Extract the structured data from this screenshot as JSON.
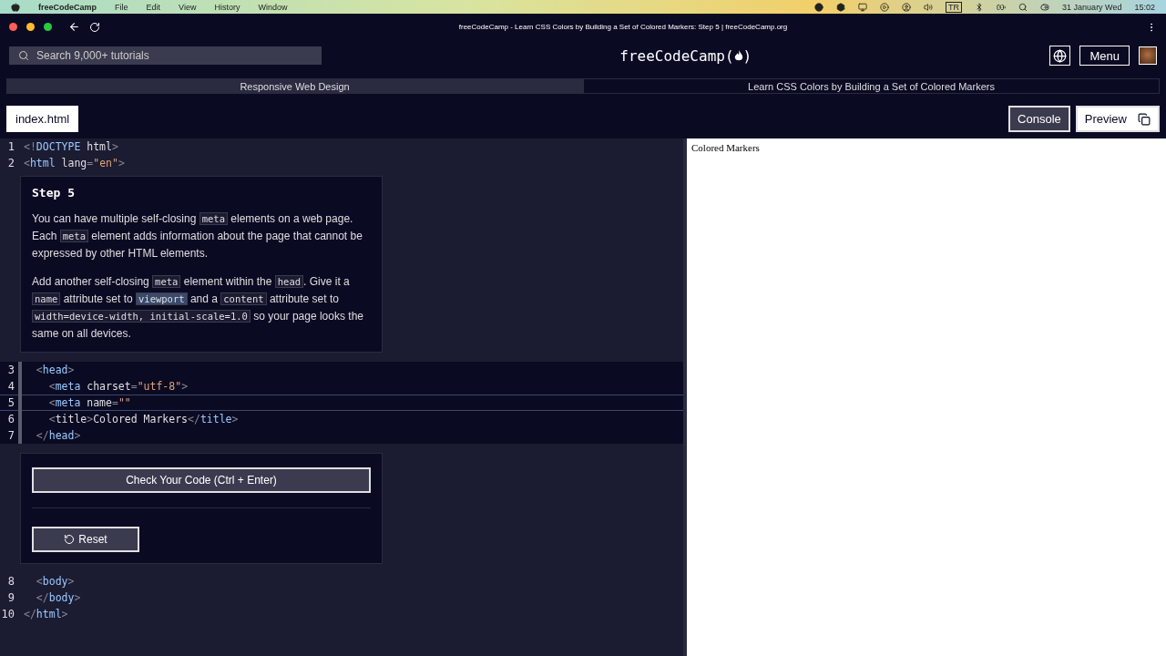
{
  "menu_bar": {
    "app": "freeCodeCamp",
    "items": [
      "File",
      "Edit",
      "View",
      "History",
      "Window"
    ],
    "input_source": "TR",
    "date": "31 January Wed",
    "time": "15:02"
  },
  "browser": {
    "title": "freeCodeCamp - Learn CSS Colors by Building a Set of Colored Markers: Step 5 | freeCodeCamp.org"
  },
  "nav": {
    "search": {
      "placeholder": "Search 9,000+ tutorials"
    },
    "logo": {
      "text": "freeCodeCamp",
      "open": "(",
      "close": ")"
    },
    "menu_button": "Menu"
  },
  "breadcrumb": [
    "Responsive Web Design",
    "Learn CSS Colors by Building a Set of Colored Markers"
  ],
  "file_tabs": [
    {
      "label": "index.html",
      "selected": true
    }
  ],
  "view_buttons": [
    {
      "label": "Console",
      "selected": false
    },
    {
      "label": "Preview",
      "selected": true
    }
  ],
  "editor": {
    "lines_before": [
      {
        "number": "1",
        "editable": false,
        "active": false,
        "tokens": [
          {
            "kind": "punct",
            "text": "<!"
          },
          {
            "kind": "tag",
            "text": "DOCTYPE"
          },
          {
            "kind": "attr",
            "text": " html"
          },
          {
            "kind": "punct",
            "text": ">"
          }
        ]
      },
      {
        "number": "2",
        "editable": false,
        "active": false,
        "tokens": [
          {
            "kind": "punct",
            "text": "<"
          },
          {
            "kind": "tag",
            "text": "html"
          },
          {
            "kind": "attr",
            "text": " lang"
          },
          {
            "kind": "punct",
            "text": "="
          },
          {
            "kind": "str",
            "text": "\"en\""
          },
          {
            "kind": "punct",
            "text": ">"
          }
        ]
      }
    ],
    "step": {
      "title": "Step 5",
      "paragraphs": [
        [
          {
            "kind": "text",
            "text": "You can have multiple self-closing "
          },
          {
            "kind": "code",
            "text": "meta",
            "highlighted": false
          },
          {
            "kind": "text",
            "text": " elements on a web page. Each "
          },
          {
            "kind": "code",
            "text": "meta",
            "highlighted": false
          },
          {
            "kind": "text",
            "text": " element adds information about the page that cannot be expressed by other HTML elements."
          }
        ],
        [
          {
            "kind": "text",
            "text": "Add another self-closing "
          },
          {
            "kind": "code",
            "text": "meta",
            "highlighted": false
          },
          {
            "kind": "text",
            "text": " element within the "
          },
          {
            "kind": "code",
            "text": "head",
            "highlighted": false
          },
          {
            "kind": "text",
            "text": ". Give it a "
          },
          {
            "kind": "code",
            "text": "name",
            "highlighted": false
          },
          {
            "kind": "text",
            "text": " attribute set to "
          },
          {
            "kind": "code",
            "text": "viewport",
            "highlighted": true
          },
          {
            "kind": "text",
            "text": " and a "
          },
          {
            "kind": "code",
            "text": "content",
            "highlighted": false
          },
          {
            "kind": "text",
            "text": " attribute set to "
          },
          {
            "kind": "code",
            "text": "width=device-width, initial-scale=1.0",
            "highlighted": false
          },
          {
            "kind": "text",
            "text": " so your page looks the same on all devices."
          }
        ]
      ]
    },
    "lines_editable": [
      {
        "number": "3",
        "editable": true,
        "active": false,
        "tokens": [
          {
            "kind": "punct",
            "text": "  <"
          },
          {
            "kind": "tag",
            "text": "head"
          },
          {
            "kind": "punct",
            "text": ">"
          }
        ]
      },
      {
        "number": "4",
        "editable": true,
        "active": false,
        "tokens": [
          {
            "kind": "punct",
            "text": "    <"
          },
          {
            "kind": "tag",
            "text": "meta"
          },
          {
            "kind": "attr",
            "text": " charset"
          },
          {
            "kind": "punct",
            "text": "="
          },
          {
            "kind": "str",
            "text": "\"utf-8\""
          },
          {
            "kind": "punct",
            "text": ">"
          }
        ]
      },
      {
        "number": "5",
        "editable": true,
        "active": true,
        "tokens": [
          {
            "kind": "punct",
            "text": "    <"
          },
          {
            "kind": "tag",
            "text": "meta"
          },
          {
            "kind": "attr",
            "text": " name"
          },
          {
            "kind": "punct",
            "text": "="
          },
          {
            "kind": "str",
            "text": "\"\""
          }
        ]
      },
      {
        "number": "6",
        "editable": true,
        "active": false,
        "tokens": [
          {
            "kind": "punct",
            "text": "    <"
          },
          {
            "kind": "attr",
            "text": "title"
          },
          {
            "kind": "punct",
            "text": ">"
          },
          {
            "kind": "attr",
            "text": "Colored Markers"
          },
          {
            "kind": "punct",
            "text": "</"
          },
          {
            "kind": "tag",
            "text": "title"
          },
          {
            "kind": "punct",
            "text": ">"
          }
        ]
      },
      {
        "number": "7",
        "editable": true,
        "active": false,
        "tokens": [
          {
            "kind": "punct",
            "text": "  </"
          },
          {
            "kind": "tag",
            "text": "head"
          },
          {
            "kind": "punct",
            "text": ">"
          }
        ]
      }
    ],
    "actions": {
      "check": "Check Your Code (Ctrl + Enter)",
      "reset": "Reset"
    },
    "lines_after": [
      {
        "number": "8",
        "editable": false,
        "active": false,
        "tokens": [
          {
            "kind": "punct",
            "text": "  <"
          },
          {
            "kind": "tag",
            "text": "body"
          },
          {
            "kind": "punct",
            "text": ">"
          }
        ]
      },
      {
        "number": "9",
        "editable": false,
        "active": false,
        "tokens": [
          {
            "kind": "punct",
            "text": "  </"
          },
          {
            "kind": "tag",
            "text": "body"
          },
          {
            "kind": "punct",
            "text": ">"
          }
        ]
      },
      {
        "number": "10",
        "editable": false,
        "active": false,
        "tokens": [
          {
            "kind": "punct",
            "text": "</"
          },
          {
            "kind": "tag",
            "text": "html"
          },
          {
            "kind": "punct",
            "text": ">"
          }
        ]
      }
    ]
  },
  "preview": {
    "text": "Colored Markers"
  }
}
